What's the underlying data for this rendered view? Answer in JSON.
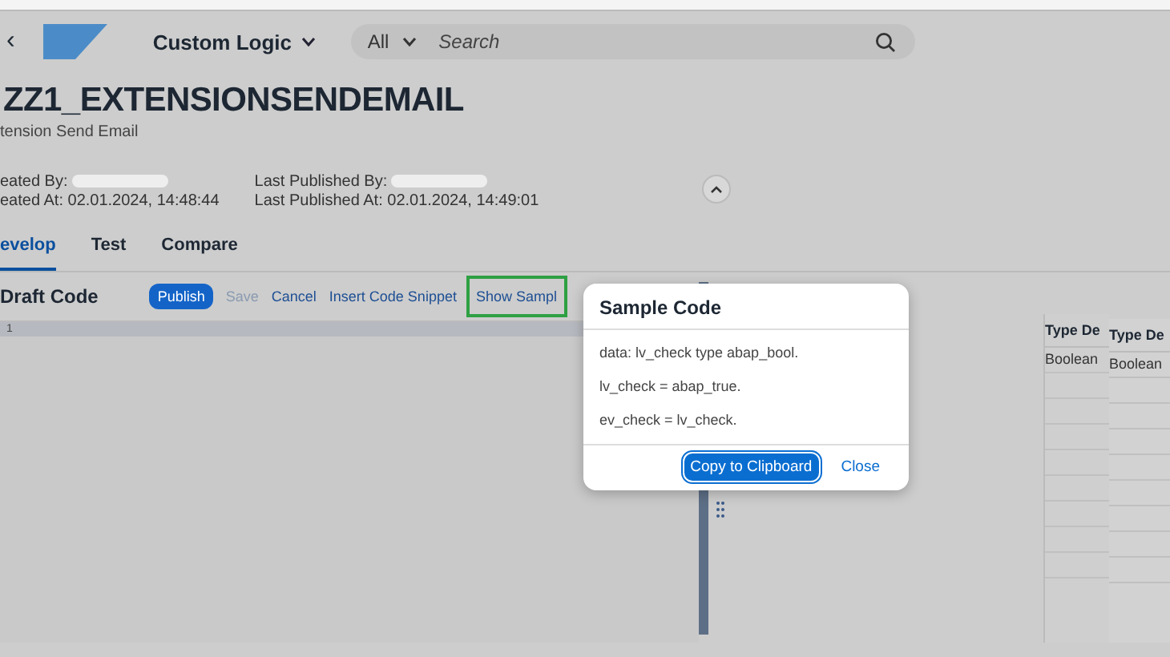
{
  "shell": {
    "back": "‹",
    "app_title": "Custom Logic",
    "search_scope": "All",
    "search_placeholder": "Search"
  },
  "object": {
    "title": "ZZ1_EXTENSIONSENDEMAIL",
    "subtitle": "tension Send Email",
    "meta": [
      {
        "label": "eated By:"
      },
      {
        "label": "eated At:",
        "value": "02.01.2024, 14:48:44"
      },
      {
        "label": "Last Published By:"
      },
      {
        "label": "Last Published At:",
        "value": "02.01.2024, 14:49:01"
      }
    ]
  },
  "tabs": [
    {
      "label": "evelop",
      "selected": true
    },
    {
      "label": "Test",
      "selected": false
    },
    {
      "label": "Compare",
      "selected": false
    }
  ],
  "toolbar": {
    "title": "Draft Code",
    "buttons": [
      {
        "label": "Publish",
        "kind": "primary",
        "disabled": false
      },
      {
        "label": "Save",
        "kind": "link",
        "disabled": true
      },
      {
        "label": "Cancel",
        "kind": "link",
        "disabled": false
      },
      {
        "label": "Insert Code Snippet",
        "kind": "link",
        "disabled": false
      },
      {
        "label": "Show Sampl",
        "kind": "link",
        "disabled": false,
        "highlighted": true
      }
    ]
  },
  "editor": {
    "line_numbers": [
      "1"
    ]
  },
  "tables": [
    {
      "column": "Type De",
      "cell": "Boolean"
    },
    {
      "column": "Type De",
      "cell": "Boolean"
    }
  ],
  "dialog": {
    "title": "Sample Code",
    "lines": [
      "data: lv_check type abap_bool.",
      "lv_check = abap_true.",
      "ev_check = lv_check."
    ],
    "buttons": [
      {
        "label": "Copy to Clipboard",
        "kind": "emphasized"
      },
      {
        "label": "Close",
        "kind": "link"
      }
    ]
  }
}
